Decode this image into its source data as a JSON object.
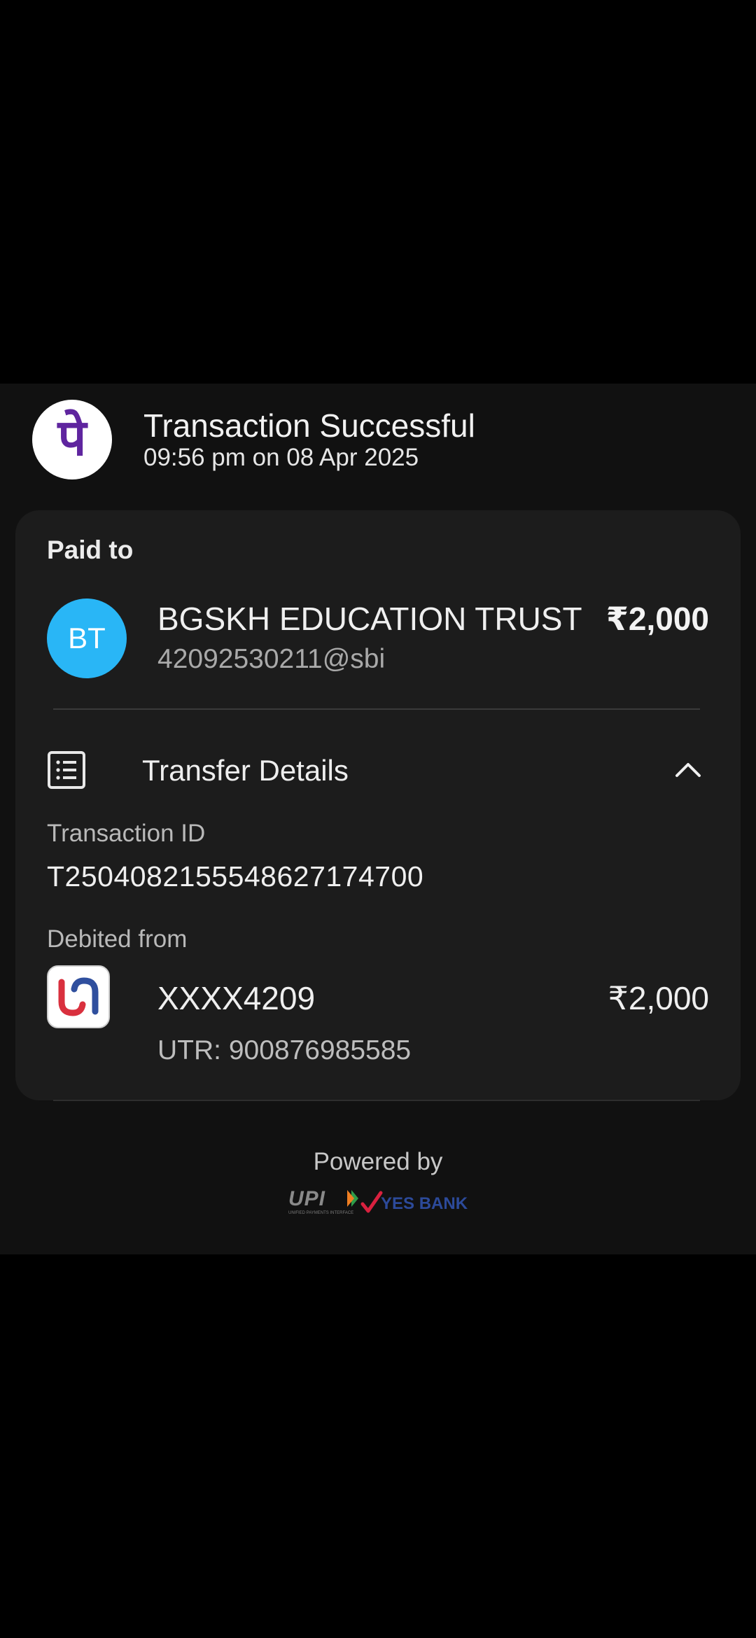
{
  "header": {
    "logo_glyph": "पे",
    "title": "Transaction Successful",
    "subtitle": "09:56 pm on 08 Apr 2025"
  },
  "paid_to": {
    "label": "Paid to",
    "avatar_initials": "BT",
    "name": "BGSKH EDUCATION TRUST",
    "vpa": "42092530211@sbi",
    "amount": "₹2,000"
  },
  "transfer_details": {
    "label": "Transfer Details",
    "expanded": true,
    "transaction_id_label": "Transaction ID",
    "transaction_id": "T2504082155548627174700",
    "debited_from_label": "Debited from",
    "account": "XXXX4209",
    "amount": "₹2,000",
    "utr": "UTR: 900876985585"
  },
  "footer": {
    "powered_by": "Powered by",
    "upi_logo_text": "UPI",
    "upi_logo_subtext": "UNIFIED PAYMENTS INTERFACE",
    "bank_name": "YES BANK"
  },
  "colors": {
    "background": "#000000",
    "sheet": "#111111",
    "card": "#1c1c1c",
    "phonepe_purple": "#5f259f",
    "avatar_blue": "#29b6f6",
    "yes_bank_blue": "#2c4a9a",
    "yes_bank_red": "#d9213f"
  }
}
